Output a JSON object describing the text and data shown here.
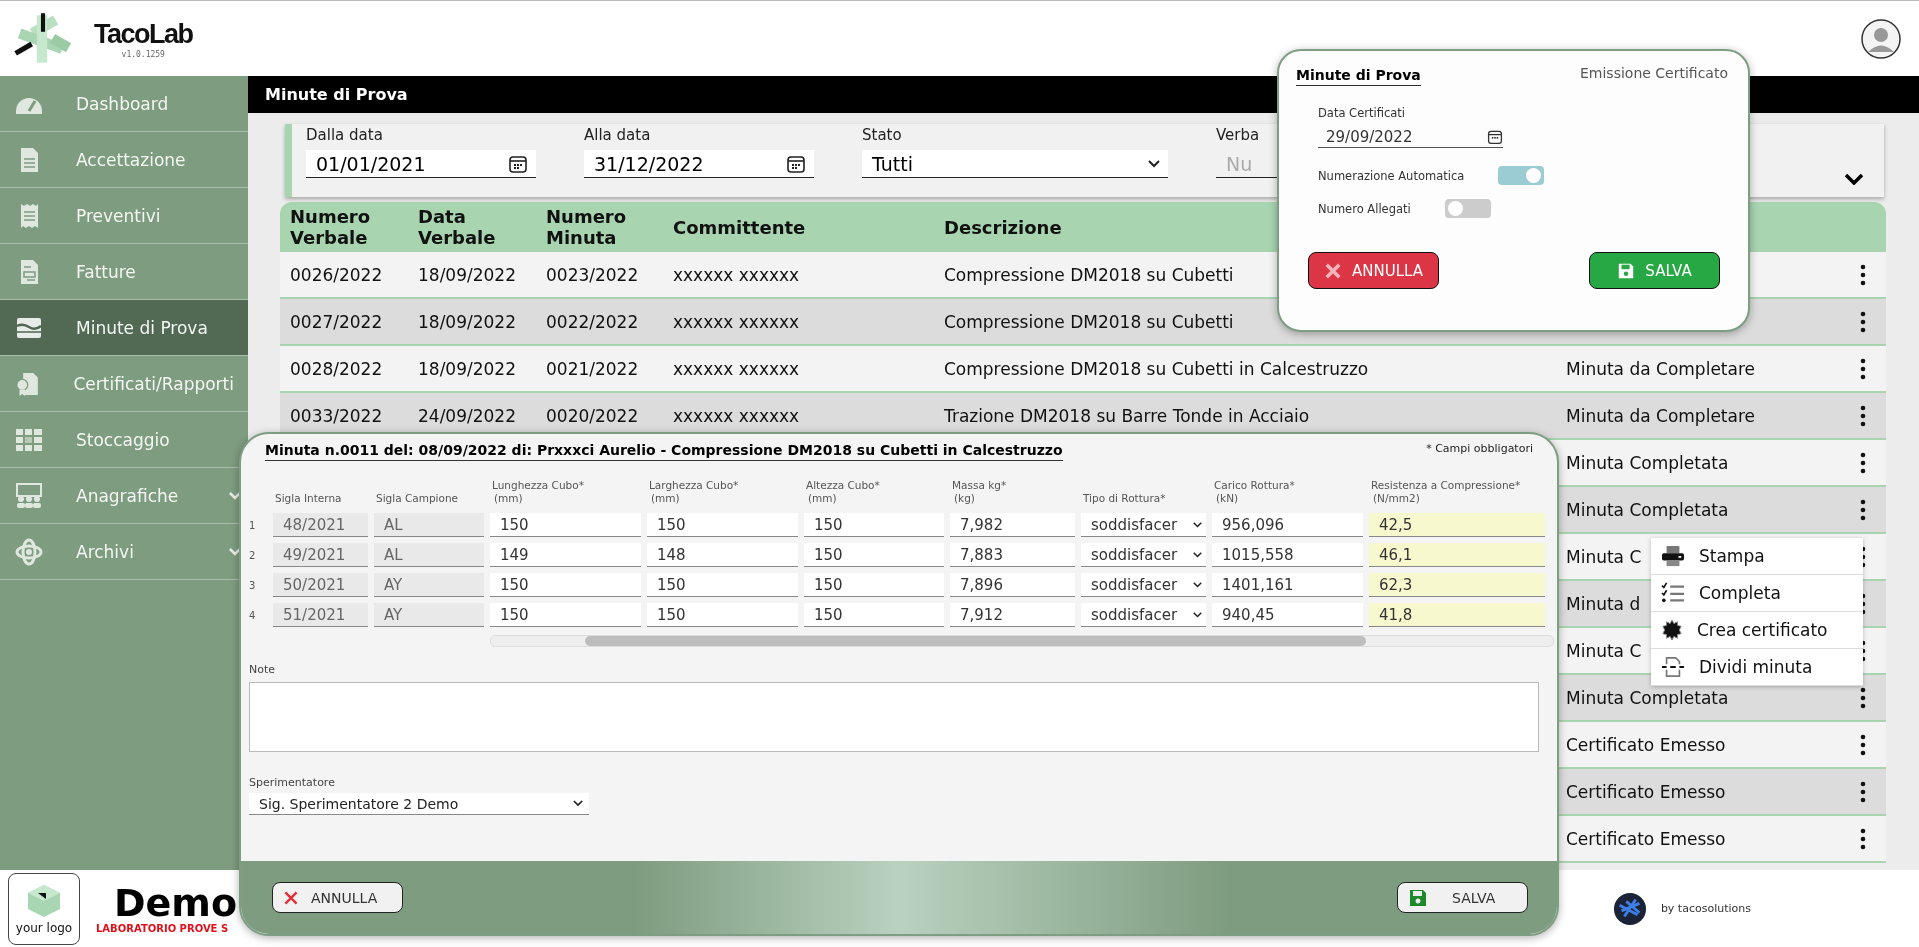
{
  "app": {
    "name": "TacoLab",
    "version": "v1.0.1259"
  },
  "sidebar": {
    "items": [
      {
        "label": "Dashboard",
        "selected": false,
        "expandable": false
      },
      {
        "label": "Accettazione",
        "selected": false,
        "expandable": false
      },
      {
        "label": "Preventivi",
        "selected": false,
        "expandable": false
      },
      {
        "label": "Fatture",
        "selected": false,
        "expandable": false
      },
      {
        "label": "Minute di Prova",
        "selected": true,
        "expandable": false
      },
      {
        "label": "Certificati/Rapporti",
        "selected": false,
        "expandable": false
      },
      {
        "label": "Stoccaggio",
        "selected": false,
        "expandable": false
      },
      {
        "label": "Anagrafiche",
        "selected": false,
        "expandable": true
      },
      {
        "label": "Archivi",
        "selected": false,
        "expandable": true
      }
    ]
  },
  "page_title": "Minute di Prova",
  "filters": [
    {
      "kind": "date",
      "label": "Dalla data",
      "value": "01/01/2021"
    },
    {
      "kind": "date",
      "label": "Alla data",
      "value": "31/12/2022"
    },
    {
      "kind": "select",
      "label": "Stato",
      "value": "Tutti"
    },
    {
      "kind": "text",
      "label": "Verba",
      "placeholder": "Nu"
    }
  ],
  "table": {
    "columns": [
      "Numero Verbale",
      "Data Verbale",
      "Numero Minuta",
      "Committente",
      "Descrizione"
    ],
    "rows": [
      {
        "cells": [
          "0026/2022",
          "18/09/2022",
          "0023/2022",
          "xxxxxx xxxxxx",
          "Compressione DM2018 su Cubetti"
        ]
      },
      {
        "cells": [
          "0027/2022",
          "18/09/2022",
          "0022/2022",
          "xxxxxx xxxxxx",
          "Compressione DM2018 su Cubetti"
        ]
      },
      {
        "cells": [
          "0028/2022",
          "18/09/2022",
          "0021/2022",
          "xxxxxx xxxxxx",
          "Compressione DM2018 su Cubetti in Calcestruzzo"
        ],
        "status": "Minuta da Completare"
      },
      {
        "cells": [
          "0033/2022",
          "24/09/2022",
          "0020/2022",
          "xxxxxx xxxxxx",
          "Trazione DM2018 su Barre Tonde in Acciaio"
        ],
        "status": "Minuta da Completare"
      },
      {
        "status": "Minuta Completata"
      },
      {
        "status": "Minuta Completata"
      },
      {
        "status": "Minuta C"
      },
      {
        "status": "Minuta d"
      },
      {
        "status": "Minuta C"
      },
      {
        "status": "Minuta Completata"
      },
      {
        "status": "Certificato Emesso"
      },
      {
        "status": "Certificato Emesso"
      },
      {
        "status": "Certificato Emesso"
      }
    ]
  },
  "popup": {
    "title": "Minute di Prova",
    "subtitle": "Emissione Certificato",
    "date_label": "Data Certificati",
    "date_value": "29/09/2022",
    "toggles": [
      {
        "label": "Numerazione Automatica",
        "on": true
      },
      {
        "label": "Numero Allegati",
        "on": false
      }
    ],
    "buttons": [
      {
        "kind": "cancel",
        "label": "ANNULLA"
      },
      {
        "kind": "save",
        "label": "SALVA"
      }
    ]
  },
  "context_menu": {
    "items": [
      {
        "label": "Stampa"
      },
      {
        "label": "Completa"
      },
      {
        "label": "Crea certificato"
      },
      {
        "label": "Dividi minuta"
      }
    ]
  },
  "modal": {
    "title": "Minuta n.0011 del: 08/09/2022 di: Prxxxci Aurelio - Compressione DM2018 su Cubetti in Calcestruzzo",
    "required_note": "* Campi obbligatori",
    "columns": [
      {
        "label": "Sigla Interna",
        "kind": "readonly"
      },
      {
        "label": "Sigla Campione",
        "kind": "readonly"
      },
      {
        "label": "Lunghezza Cubo*",
        "unit": "(mm)",
        "kind": "input"
      },
      {
        "label": "Larghezza Cubo*",
        "unit": "(mm)",
        "kind": "input"
      },
      {
        "label": "Altezza Cubo*",
        "unit": "(mm)",
        "kind": "input"
      },
      {
        "label": "Massa kg*",
        "unit": "(kg)",
        "kind": "input"
      },
      {
        "label": "Tipo di Rottura*",
        "kind": "select"
      },
      {
        "label": "Carico Rottura*",
        "unit": "(kN)",
        "kind": "input"
      },
      {
        "label": "Resistenza a Compressione*",
        "unit": "(N/mm2)",
        "kind": "result"
      }
    ],
    "rows": [
      {
        "number": "1",
        "cells": [
          "48/2021",
          "AL",
          "150",
          "150",
          "150",
          "7,982",
          "soddisfacer",
          "956,096",
          "42,5"
        ]
      },
      {
        "number": "2",
        "cells": [
          "49/2021",
          "AL",
          "149",
          "148",
          "150",
          "7,883",
          "soddisfacer",
          "1015,558",
          "46,1"
        ]
      },
      {
        "number": "3",
        "cells": [
          "50/2021",
          "AY",
          "150",
          "150",
          "150",
          "7,896",
          "soddisfacer",
          "1401,161",
          "62,3"
        ]
      },
      {
        "number": "4",
        "cells": [
          "51/2021",
          "AY",
          "150",
          "150",
          "150",
          "7,912",
          "soddisfacer",
          "940,45",
          "41,8"
        ]
      }
    ],
    "note_label": "Note",
    "operator_label": "Sperimentatore",
    "operator_value": "Sig. Sperimentatore 2 Demo",
    "buttons": [
      {
        "kind": "cancel",
        "label": "ANNULLA"
      },
      {
        "kind": "save",
        "label": "SALVA"
      }
    ]
  },
  "footer": {
    "logo_text": "your logo",
    "company": "Demo",
    "company_sub": "LABORATORIO PROVE S",
    "credit": "by tacosolutions"
  }
}
